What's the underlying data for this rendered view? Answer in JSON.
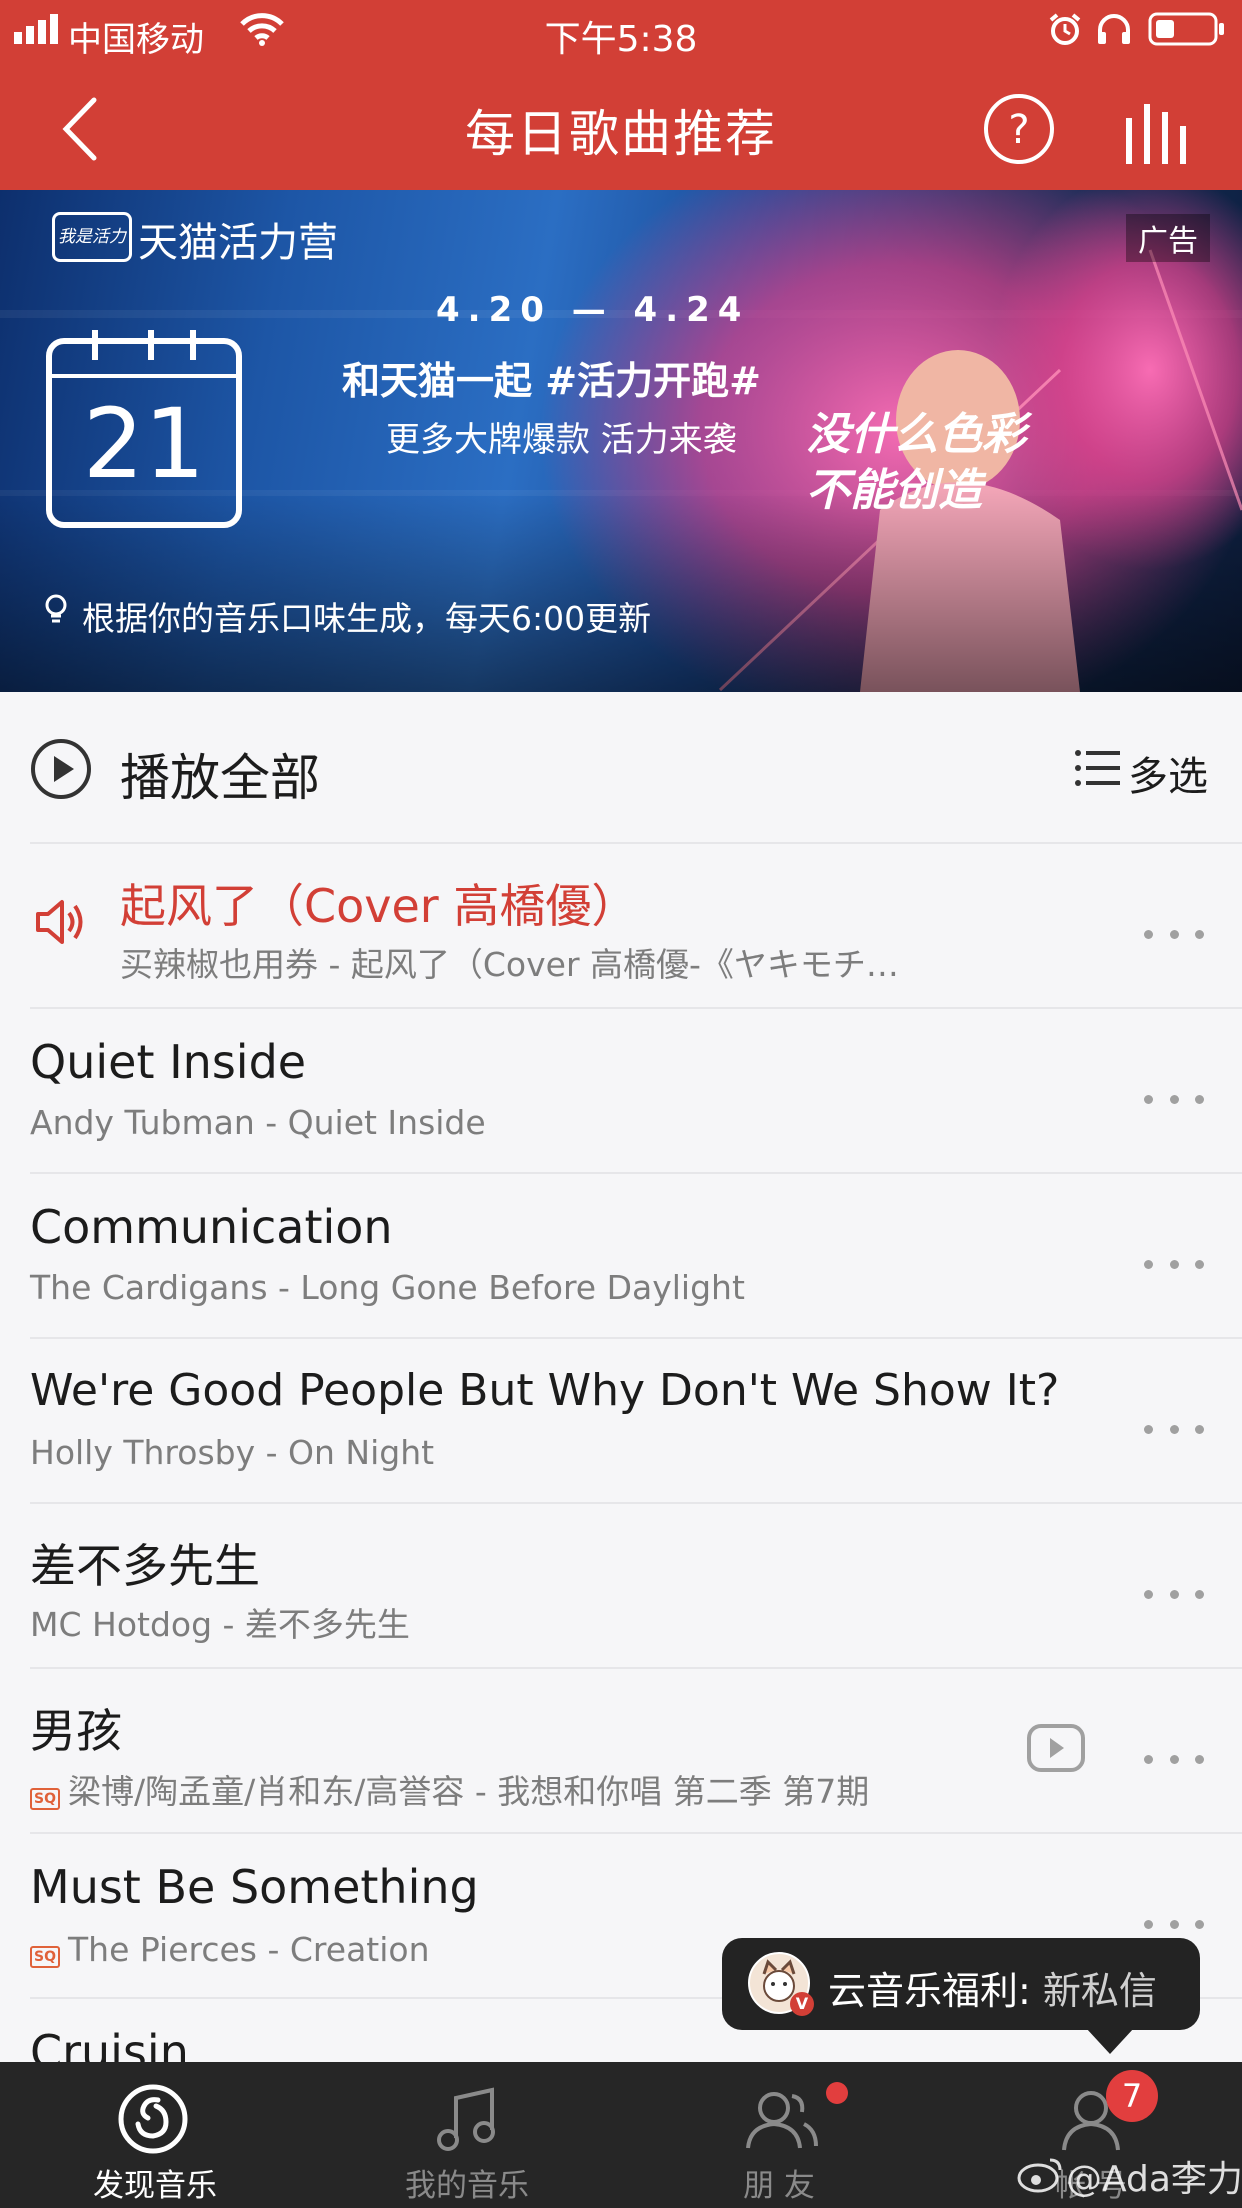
{
  "status": {
    "carrier": "中国移动",
    "time": "下午5:38"
  },
  "nav": {
    "title": "每日歌曲推荐"
  },
  "banner": {
    "brand_tag": "我是活力",
    "brand_name": "天猫活力营",
    "ad_label": "广告",
    "date_range": "4.20 — 4.24",
    "headline": "和天猫一起 #活力开跑#",
    "subline": "更多大牌爆款  活力来袭",
    "slogan_1": "没什么色彩",
    "slogan_2": "不能创造",
    "calendar_day": "21",
    "note": "根据你的音乐口味生成，每天6:00更新"
  },
  "controls": {
    "play_all": "播放全部",
    "multi_select": "多选"
  },
  "songs": [
    {
      "title": "起风了（Cover 高橋優）",
      "subtitle": "买辣椒也用券 - 起风了（Cover 高橋優-《ヤキモチ…",
      "playing": true
    },
    {
      "title": "Quiet Inside",
      "subtitle": "Andy Tubman - Quiet Inside"
    },
    {
      "title": "Communication",
      "subtitle": "The Cardigans - Long Gone Before Daylight"
    },
    {
      "title": "We're Good People But Why Don't We Show It?",
      "subtitle": "Holly Throsby - On Night"
    },
    {
      "title": "差不多先生",
      "subtitle": "MC Hotdog - 差不多先生"
    },
    {
      "title": "男孩",
      "subtitle": "梁博/陶孟童/肖和东/高誉容 - 我想和你唱 第二季 第7期",
      "sq": "SQ",
      "has_mv": true
    },
    {
      "title": "Must Be Something",
      "subtitle": "The Pierces - Creation",
      "sq": "SQ"
    },
    {
      "title": "Cruisin"
    }
  ],
  "toast": {
    "label": "云音乐福利:",
    "value": "新私信",
    "badge": "V"
  },
  "tabs": [
    {
      "label": "发现音乐",
      "active": true
    },
    {
      "label": "我的音乐"
    },
    {
      "label": "朋 友"
    },
    {
      "label": "帐 号",
      "badge": "7"
    }
  ],
  "watermark": "@Ada李力",
  "colors": {
    "brand_red": "#d23f36",
    "tabbar": "#262626",
    "background": "#f6f6f8"
  }
}
